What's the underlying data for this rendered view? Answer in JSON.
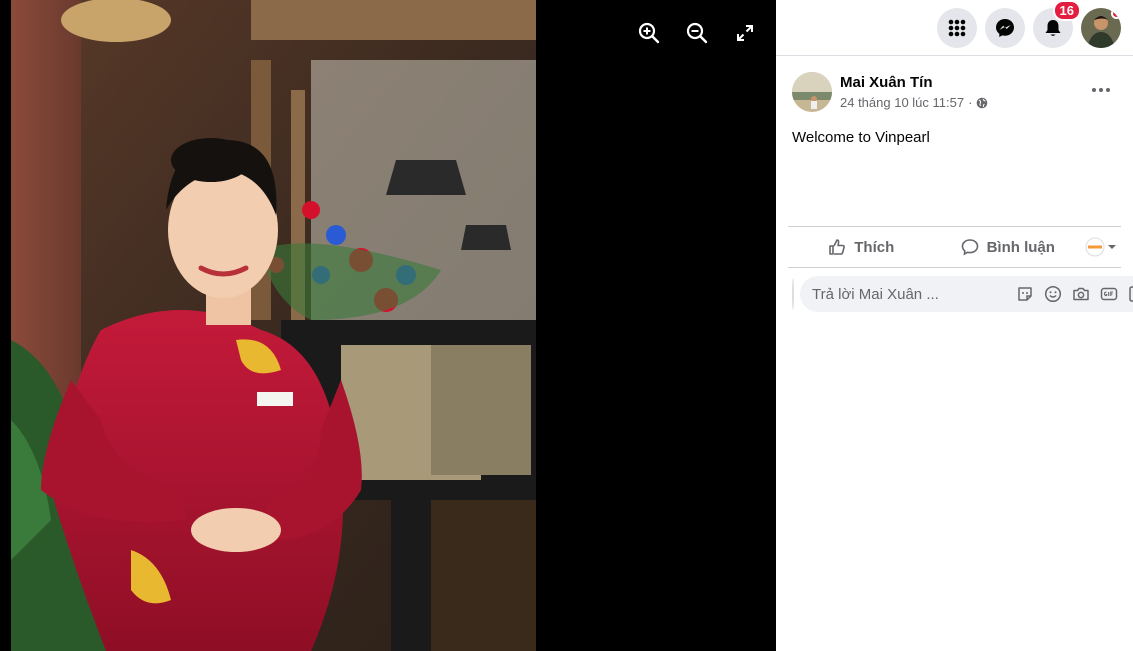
{
  "topbar": {
    "menu_icon": "grid-menu-icon",
    "messenger_icon": "messenger-icon",
    "notifications_icon": "bell-icon",
    "notification_count": "16"
  },
  "viewer": {
    "zoom_in_icon": "zoom-in-icon",
    "zoom_out_icon": "zoom-out-icon",
    "fullscreen_icon": "expand-icon"
  },
  "post": {
    "author": "Mai Xuân Tín",
    "timestamp": "24 tháng 10 lúc 11:57",
    "privacy_icon": "globe-icon",
    "text": "Welcome to Vinpearl",
    "like_label": "Thích",
    "comment_label": "Bình luận"
  },
  "comment": {
    "placeholder": "Trả lời Mai Xuân ..."
  },
  "colors": {
    "accent": "#1877f2",
    "badge": "#e41e3f",
    "secondary_text": "#65676b"
  }
}
